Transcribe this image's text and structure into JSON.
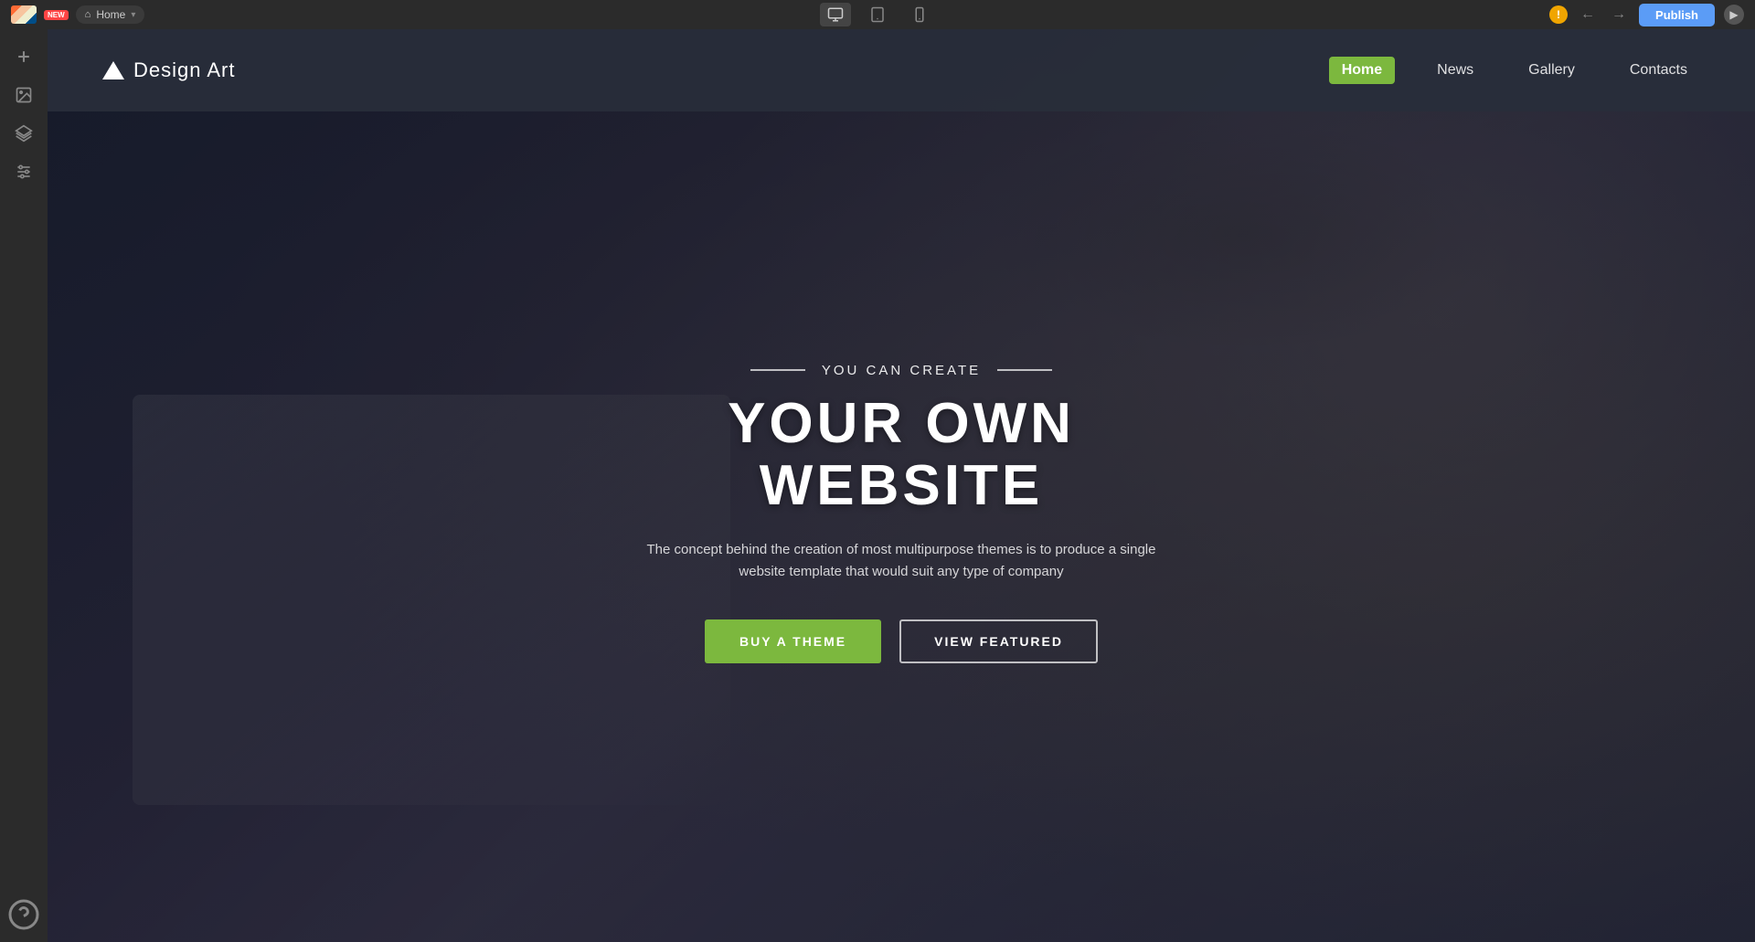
{
  "os_bar": {
    "logo_alt": "App logo",
    "badge": "NEW",
    "home_label": "Home",
    "publish_label": "Publish"
  },
  "nav_items": [
    {
      "label": "Home",
      "active": true
    },
    {
      "label": "News",
      "active": false
    },
    {
      "label": "Gallery",
      "active": false
    },
    {
      "label": "Contacts",
      "active": false
    }
  ],
  "site": {
    "logo_text": "Design Art",
    "tagline": "YOU CAN CREATE",
    "hero_title": "YOUR OWN WEBSITE",
    "hero_description": "The concept behind the creation of most multipurpose themes is to produce a single website template that would suit any type of company",
    "btn_primary": "BUY A THEME",
    "btn_secondary": "VIEW FEATURED"
  },
  "colors": {
    "active_nav": "#7cb83e",
    "publish_btn": "#5b9cf6",
    "warning": "#f0a500"
  }
}
